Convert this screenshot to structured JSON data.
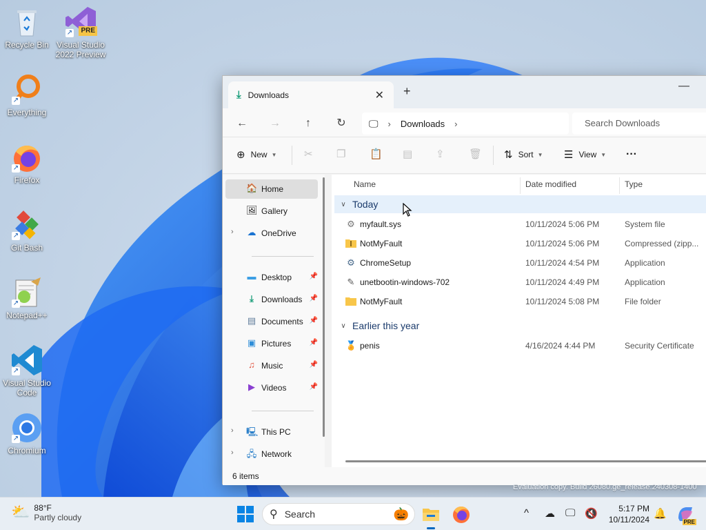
{
  "desktop": {
    "icons": [
      {
        "label": "Recycle Bin"
      },
      {
        "label": "Visual Studio 2022 Preview",
        "badge": "PRE"
      },
      {
        "label": "Everything"
      },
      {
        "label": "Firefox"
      },
      {
        "label": "Git Bash"
      },
      {
        "label": "Notepad++"
      },
      {
        "label": "Visual Studio Code"
      },
      {
        "label": "Chromium"
      }
    ]
  },
  "window": {
    "tab_title": "Downloads",
    "tab_close": "✕",
    "new_tab": "+",
    "minimize": "—",
    "address": {
      "crumbs": [
        "Downloads"
      ],
      "search_placeholder": "Search Downloads"
    },
    "toolbar": {
      "new_label": "New",
      "sort_label": "Sort",
      "view_label": "View",
      "more_label": "···"
    },
    "nav": {
      "home": "Home",
      "gallery": "Gallery",
      "onedrive": "OneDrive",
      "desktop": "Desktop",
      "downloads": "Downloads",
      "documents": "Documents",
      "pictures": "Pictures",
      "music": "Music",
      "videos": "Videos",
      "thispc": "This PC",
      "network": "Network"
    },
    "columns": {
      "name": "Name",
      "date": "Date modified",
      "type": "Type"
    },
    "groups": {
      "today": "Today",
      "earlier": "Earlier this year"
    },
    "files": [
      {
        "name": "myfault.sys",
        "date": "10/11/2024 5:06 PM",
        "type": "System file",
        "icon": "system-file-icon"
      },
      {
        "name": "NotMyFault",
        "date": "10/11/2024 5:06 PM",
        "type": "Compressed (zipp...",
        "icon": "zip-folder-icon"
      },
      {
        "name": "ChromeSetup",
        "date": "10/11/2024 4:54 PM",
        "type": "Application",
        "icon": "app-icon"
      },
      {
        "name": "unetbootin-windows-702",
        "date": "10/11/2024 4:49 PM",
        "type": "Application",
        "icon": "app-icon"
      },
      {
        "name": "NotMyFault",
        "date": "10/11/2024 5:08 PM",
        "type": "File folder",
        "icon": "folder-icon"
      },
      {
        "name": "penis",
        "date": "4/16/2024 4:44 PM",
        "type": "Security Certificate",
        "icon": "certificate-icon"
      }
    ],
    "status": "6 items"
  },
  "watermark": "Evaluation copy. Build 26080.ge_release.240308-1400",
  "taskbar": {
    "weather_temp": "88°F",
    "weather_cond": "Partly cloudy",
    "search_label": "Search",
    "time": "5:17 PM",
    "date": "10/11/2024",
    "copilot_badge": "PRE"
  },
  "colors": {
    "accent": "#0067c0",
    "folder": "#f8c64a",
    "wallpaper_blue": "#1a6ef0"
  }
}
